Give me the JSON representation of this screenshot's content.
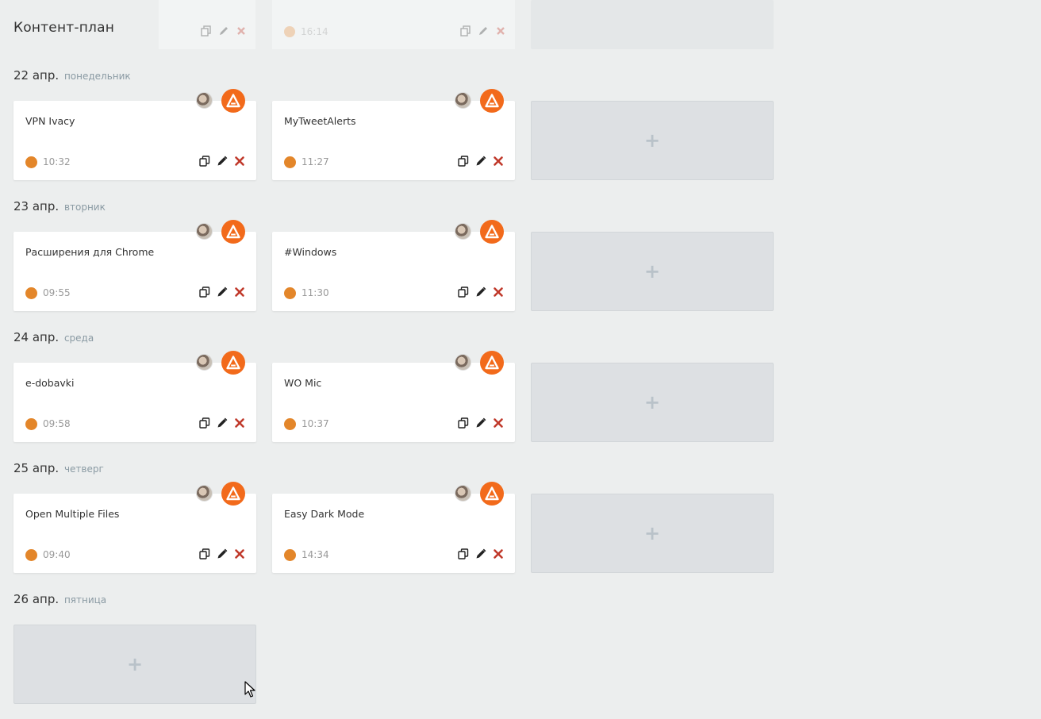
{
  "page": {
    "title": "Контент-план"
  },
  "header_ghost": {
    "time": "16:14"
  },
  "days": [
    {
      "date": "22 апр.",
      "weekday": "понедельник",
      "posts": [
        {
          "title": "VPN Ivacy",
          "time": "10:32"
        },
        {
          "title": "MyTweetAlerts",
          "time": "11:27"
        }
      ]
    },
    {
      "date": "23 апр.",
      "weekday": "вторник",
      "posts": [
        {
          "title": "Расширения для Chrome",
          "time": "09:55"
        },
        {
          "title": "#Windows",
          "time": "11:30"
        }
      ]
    },
    {
      "date": "24 апр.",
      "weekday": "среда",
      "posts": [
        {
          "title": "e-dobavki",
          "time": "09:58"
        },
        {
          "title": "WO Mic",
          "time": "10:37"
        }
      ]
    },
    {
      "date": "25 апр.",
      "weekday": "четверг",
      "posts": [
        {
          "title": "Open Multiple Files",
          "time": "09:40"
        },
        {
          "title": "Easy Dark Mode",
          "time": "14:34"
        }
      ]
    },
    {
      "date": "26 апр.",
      "weekday": "пятница",
      "posts": []
    }
  ],
  "add_slot": {
    "label": "+"
  },
  "icons": {
    "copy": "copy-icon",
    "edit": "pencil-icon",
    "delete": "close-icon",
    "brand": "brand-logo-icon",
    "avatar": "avatar"
  },
  "colors": {
    "status_dot": "#e3862a",
    "brand": "#f26a1b",
    "delete": "#c0392b",
    "background": "#eceeee"
  }
}
